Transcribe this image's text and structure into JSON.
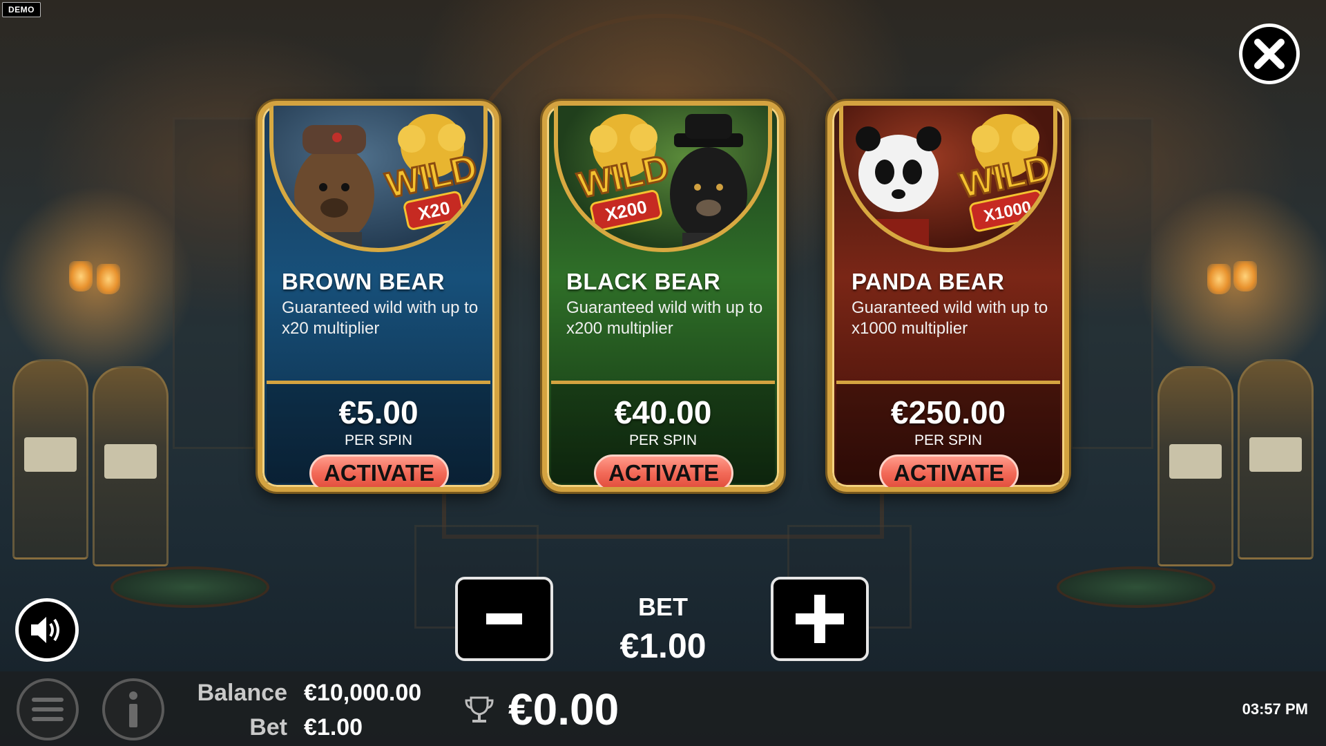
{
  "demo_tag": "DEMO",
  "close_icon": "close-icon",
  "cards": [
    {
      "theme": "blue",
      "title": "BROWN BEAR",
      "description": "Guaranteed wild with up to x20 multiplier",
      "medal_text": "WILD",
      "medal_multiplier": "X20",
      "price": "€5.00",
      "per_spin": "PER SPIN",
      "button": "ACTIVATE"
    },
    {
      "theme": "green",
      "title": "BLACK BEAR",
      "description": "Guaranteed wild with up to x200 multiplier",
      "medal_text": "WILD",
      "medal_multiplier": "X200",
      "price": "€40.00",
      "per_spin": "PER SPIN",
      "button": "ACTIVATE"
    },
    {
      "theme": "red",
      "title": "PANDA BEAR",
      "description": "Guaranteed wild with up to x1000 multiplier",
      "medal_text": "WILD",
      "medal_multiplier": "X1000",
      "price": "€250.00",
      "per_spin": "PER SPIN",
      "button": "ACTIVATE"
    }
  ],
  "bet_control": {
    "label": "BET",
    "value": "€1.00",
    "decrease_icon": "minus-icon",
    "increase_icon": "plus-icon"
  },
  "footer": {
    "balance_label": "Balance",
    "balance_value": "€10,000.00",
    "bet_label": "Bet",
    "bet_value": "€1.00",
    "win_value": "€0.00",
    "time": "03:57 PM"
  },
  "colors": {
    "gold_frame": "#d4a340",
    "activate_button": "#f26a58",
    "blue_card": "#17507a",
    "green_card": "#2f6f28",
    "red_card": "#7a2616"
  }
}
